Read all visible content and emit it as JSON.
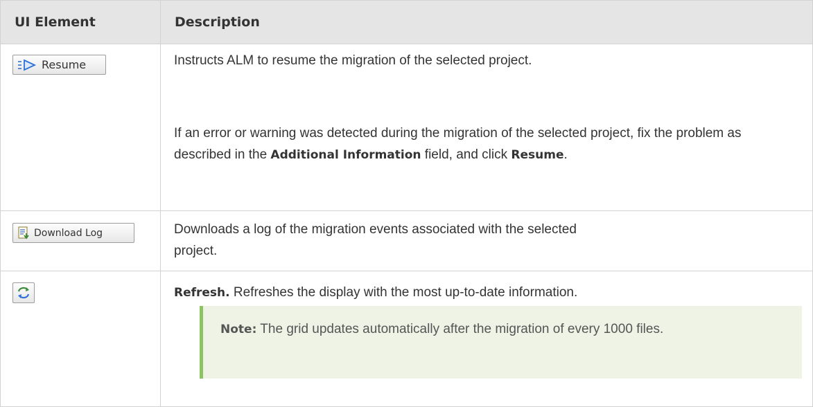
{
  "table": {
    "headers": [
      "UI Element",
      "Description"
    ],
    "rows": [
      {
        "element": {
          "icon": "resume-icon",
          "label": "Resume"
        },
        "paragraphs": [
          {
            "text": "Instructs ALM to resume the migration of the selected project."
          },
          {
            "pre": "If an error or warning was detected during the migration of the selected project, fix the problem as described in the ",
            "bold": "Additional Information",
            "mid": " field, and click ",
            "bold2": "Resume",
            "end": "."
          }
        ]
      },
      {
        "element": {
          "icon": "download-log-icon",
          "label": "Download Log"
        },
        "paragraphs": [
          {
            "text": "Downloads a log of the migration events associated with the selected project."
          }
        ]
      },
      {
        "element": {
          "icon": "refresh-icon",
          "label": ""
        },
        "paragraphs": [
          {
            "bold": "Refresh.",
            "text": " Refreshes the display with the most up-to-date information."
          }
        ],
        "note": {
          "label": "Note:",
          "text": " The grid updates automatically after the migration of every 1000 files."
        }
      }
    ]
  },
  "colors": {
    "header_bg": "#e5e5e5",
    "border": "#d2d2d2",
    "note_bg": "#eef3e6",
    "note_accent": "#8dc462",
    "icon_blue": "#2f6fd6",
    "icon_green": "#3a8a3a"
  }
}
